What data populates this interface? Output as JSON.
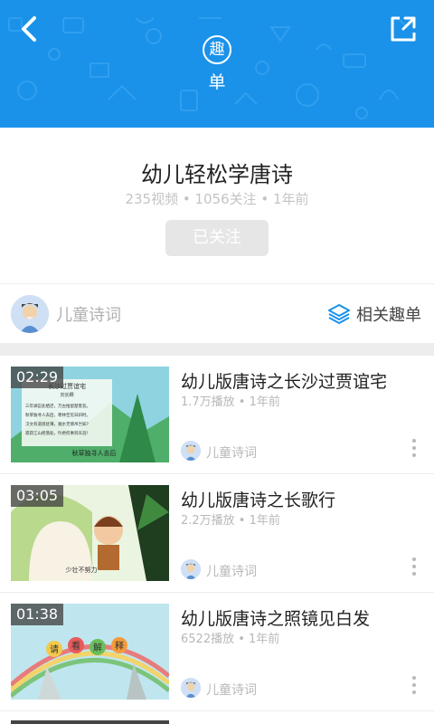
{
  "header": {
    "back_icon": "chevron-left-icon",
    "share_icon": "share-icon",
    "logo_top": "趣",
    "logo_bottom": "单",
    "bg_color": "#1a92ea"
  },
  "playlist": {
    "title": "幼儿轻松学唐诗",
    "meta": "235视频 • 1056关注 • 1年前",
    "follow_label": "已关注"
  },
  "channel": {
    "name": "儿童诗词",
    "related_label": "相关趣单",
    "related_icon": "layers-icon",
    "accent": "#1a92ea"
  },
  "videos": [
    {
      "duration": "02:29",
      "title": "幼儿版唐诗之长沙过贾谊宅",
      "meta": "1.7万播放 • 1年前",
      "channel": "儿童诗词"
    },
    {
      "duration": "03:05",
      "title": "幼儿版唐诗之长歌行",
      "meta": "2.2万播放 • 1年前",
      "channel": "儿童诗词"
    },
    {
      "duration": "01:38",
      "title": "幼儿版唐诗之照镜见白发",
      "meta": "6522播放 • 1年前",
      "channel": "儿童诗词"
    }
  ],
  "thumbs": {
    "t1_title": "长沙过贾谊宅",
    "t1_author": "刘长卿",
    "t1_lines": [
      "三年谪宦此栖迟，万古惟留楚客悲。",
      "秋草独寻人去后，寒林空见日斜时。",
      "汉文有道恩犹薄，湘水无情吊岂知？",
      "寂寂江山摇落处，怜君何事到天涯！"
    ],
    "t1_caption": "秋草独寻人去后",
    "t2_caption": "少壮不努力",
    "t3_chars": [
      "请",
      "看",
      "解",
      "释"
    ]
  }
}
